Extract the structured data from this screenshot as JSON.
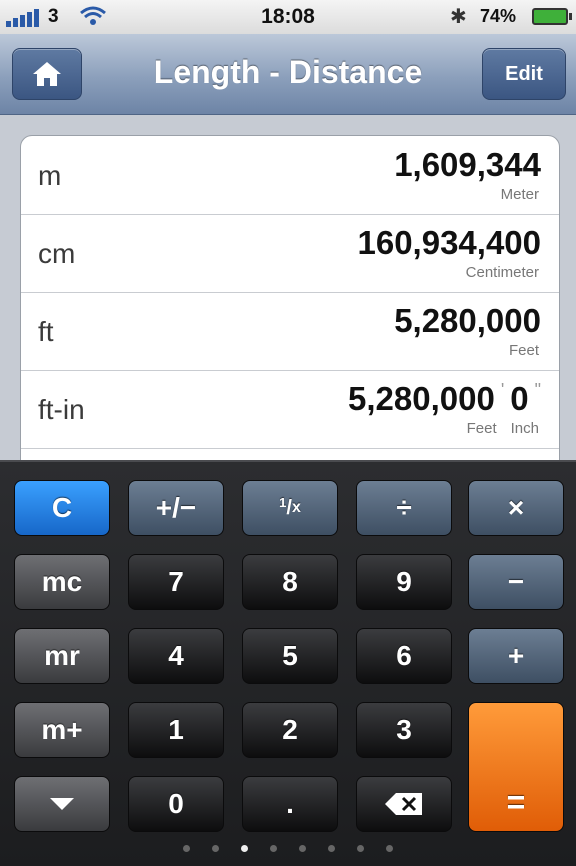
{
  "status_bar": {
    "carrier": "3",
    "time": "18:08",
    "battery_pct": "74%",
    "icons": [
      "signal-icon",
      "wifi-icon",
      "bluetooth-icon",
      "battery-icon"
    ]
  },
  "nav": {
    "title": "Length - Distance",
    "home_icon": "home-icon",
    "edit_label": "Edit",
    "bar_color": "#8b9fbb"
  },
  "units": [
    {
      "abbr": "m",
      "value": "1,609,344",
      "name": "Meter"
    },
    {
      "abbr": "cm",
      "value": "160,934,400",
      "name": "Centimeter"
    },
    {
      "abbr": "ft",
      "value": "5,280,000",
      "name": "Feet"
    },
    {
      "abbr": "ft-in",
      "value_ft": "5,280,000",
      "value_in": "0",
      "name_ft": "Feet",
      "name_in": "Inch"
    }
  ],
  "keypad": {
    "clear": "C",
    "plus_minus": "+/−",
    "reciprocal": "1/x",
    "divide": "÷",
    "multiply": "×",
    "mc": "mc",
    "mr": "mr",
    "m_plus": "m+",
    "minus": "−",
    "plus": "+",
    "equals": "=",
    "decimal": ".",
    "digits": [
      "7",
      "8",
      "9",
      "4",
      "5",
      "6",
      "1",
      "2",
      "3",
      "0"
    ],
    "down_icon": "chevron-down-icon",
    "backspace_icon": "backspace-icon",
    "colors": {
      "clear": "#1767c9",
      "operator": "#3e4f63",
      "equals": "#e05d07"
    }
  },
  "pager": {
    "count": 8,
    "active_index": 2
  }
}
